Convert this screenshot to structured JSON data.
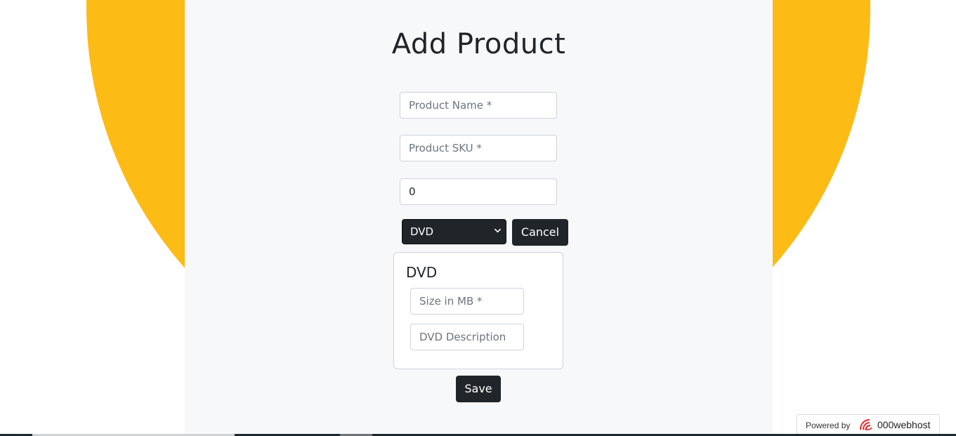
{
  "page": {
    "title": "Add Product"
  },
  "form": {
    "name_placeholder": "Product Name *",
    "sku_placeholder": "Product SKU *",
    "price_value": "0",
    "type_selected": "DVD",
    "cancel_label": "Cancel",
    "save_label": "Save"
  },
  "dvd_section": {
    "title": "DVD",
    "size_placeholder": "Size in MB *",
    "description_placeholder": "DVD Description"
  },
  "footer": {
    "powered_by": "Powered by",
    "brand": "000webhost",
    "brand_icon": "000webhost-logo-icon"
  },
  "colors": {
    "accent_yellow": "#fdbb16",
    "card_bg": "#f7f8fa",
    "dark_button": "#212529",
    "brand_red": "#e3272b"
  }
}
